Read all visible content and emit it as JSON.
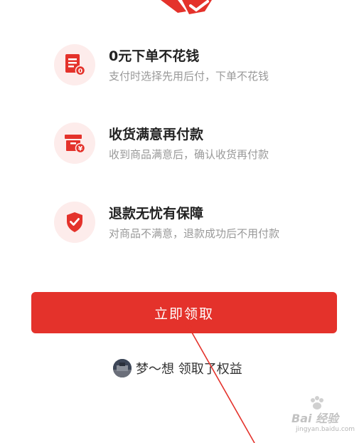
{
  "colors": {
    "accent": "#e4322b",
    "icon_background": "#fdeceb",
    "title_text": "#222222",
    "description_text": "#999999",
    "annotation_arrow": "#e4322b"
  },
  "benefits": [
    {
      "icon": "order-document-icon",
      "title": "0元下单不花钱",
      "description": "支付时选择先用后付，下单不花钱",
      "icon_badge": "0"
    },
    {
      "icon": "payment-box-icon",
      "title": "收货满意再付款",
      "description": "收到商品满意后，确认收货再付款",
      "icon_badge": "¥"
    },
    {
      "icon": "shield-check-icon",
      "title": "退款无忧有保障",
      "description": "对商品不满意，退款成功后不用付款"
    }
  ],
  "claim_button": {
    "label": "立即领取"
  },
  "claimed_notice": {
    "text": "梦～想 领取了权益"
  },
  "watermark": {
    "main": "Bai 经验",
    "sub": "jingyan.baidu.com"
  }
}
